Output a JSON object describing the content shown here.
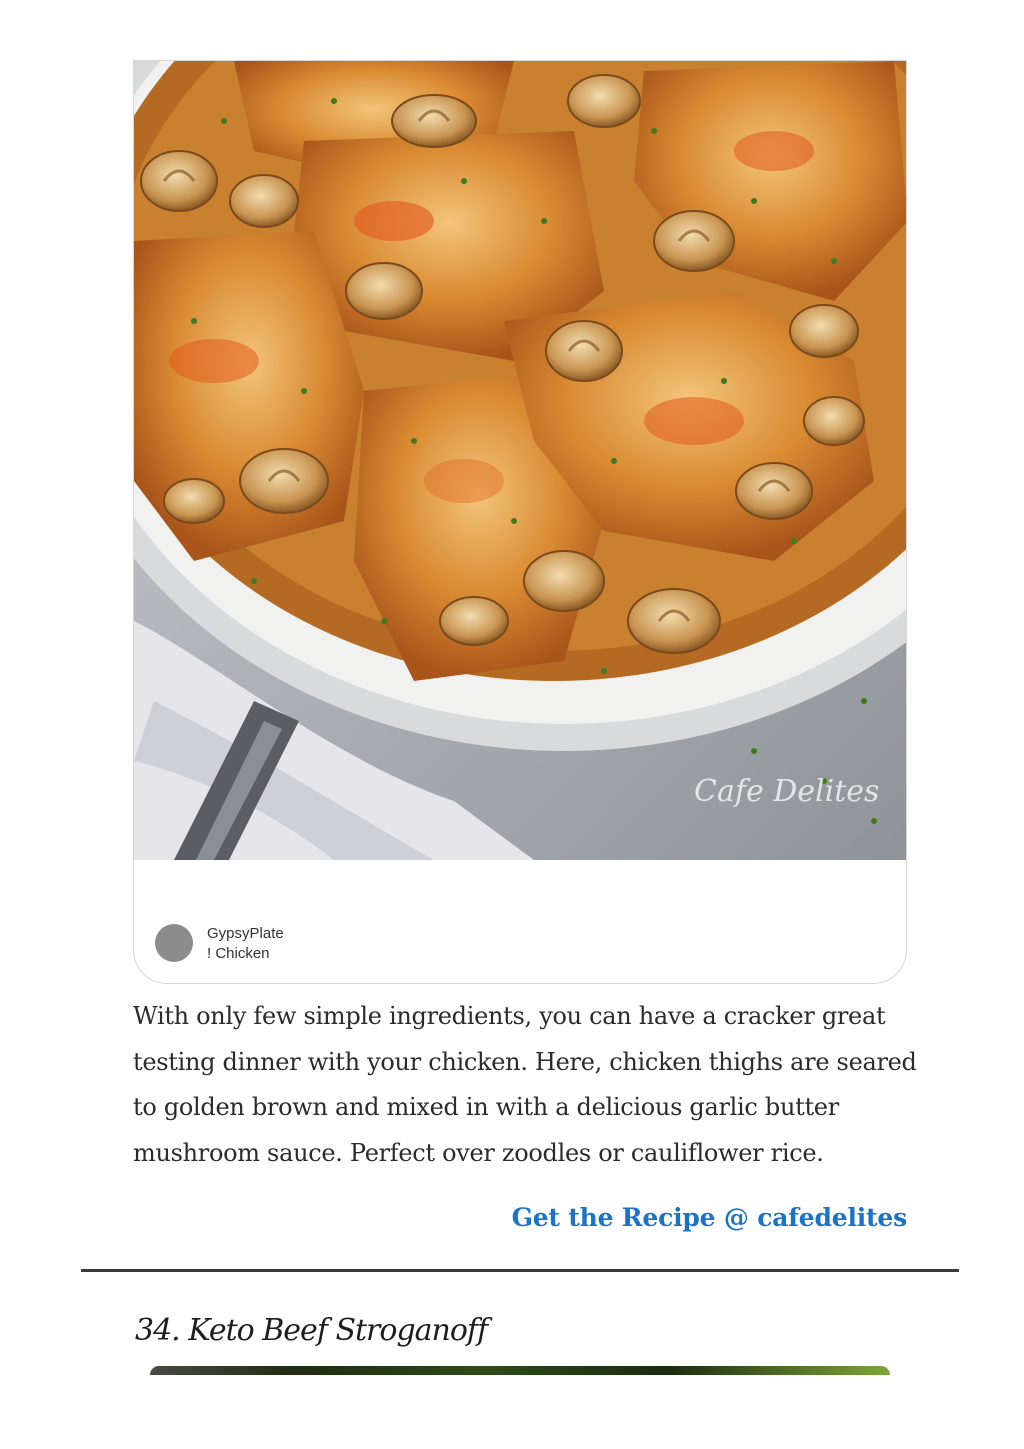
{
  "pin": {
    "image_alt": "Chicken thighs seared with garlic butter mushroom sauce in a pan",
    "watermark": "Cafe Delites",
    "source_name": "GypsyPlate",
    "board_name": "! Chicken"
  },
  "article": {
    "description": "With only few simple ingredients, you can have a cracker great testing dinner with your chicken. Here, chicken thighs are seared to golden brown and mixed in with a delicious garlic butter mushroom sauce. Perfect over zoodles or cauliflower rice.",
    "recipe_link_label": "Get the Recipe @ cafedelites"
  },
  "next_section": {
    "heading": "34. Keto Beef Stroganoff"
  },
  "colors": {
    "link": "#1a73c9",
    "divider": "#3a3a3a",
    "avatar": "#8c8c8c"
  }
}
